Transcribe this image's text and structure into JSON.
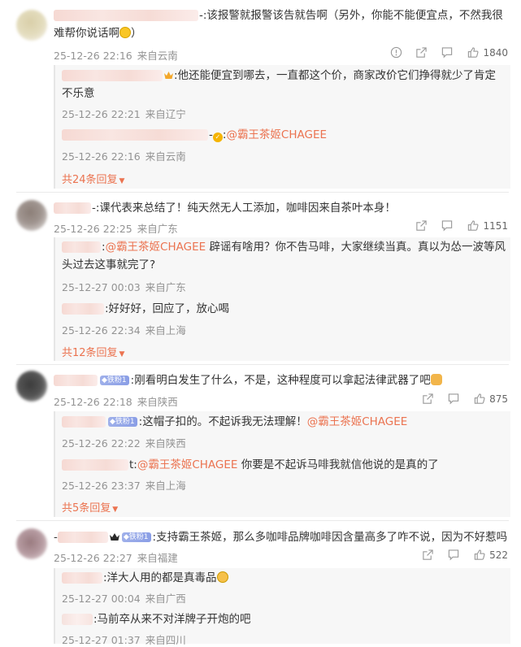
{
  "comments": [
    {
      "text": "-:该报警就报警该告就告啊（另外，你能不能便宜点，不然我很难帮你说话啊",
      "text_tail": "）",
      "time": "25-12-26 22:16",
      "location": "来自云南",
      "likes": "1840",
      "replies": [
        {
          "text": ":他还能便宜到哪去，一直都这个价，商家改价它们挣得就少了肯定不乐意",
          "time": "25-12-26 22:21",
          "location": "来自辽宁"
        },
        {
          "prefix": "-",
          "mention": "@霸王茶姬CHAGEE",
          "colon": ":",
          "time": "25-12-26 22:16",
          "location": "来自云南"
        }
      ],
      "more": "共24条回复"
    },
    {
      "text": "-:课代表来总结了！纯天然无人工添加，咖啡因来自茶叶本身！",
      "time": "25-12-26 22:25",
      "location": "来自广东",
      "likes": "1151",
      "replies": [
        {
          "colon": ":",
          "mention": "@霸王茶姬CHAGEE",
          "text": " 辟谣有啥用？你不告马啡，大家继续当真。真以为怂一波等风头过去这事就完了?",
          "time": "25-12-27 00:03",
          "location": "来自广东"
        },
        {
          "text": ":好好好，回应了，放心喝",
          "time": "25-12-26 22:34",
          "location": "来自上海"
        }
      ],
      "more": "共12条回复"
    },
    {
      "badge": "铁粉1",
      "text": ":刚看明白发生了什么，不是，这种程度可以拿起法律武器了吧",
      "time": "25-12-26 22:18",
      "location": "来自陕西",
      "likes": "875",
      "replies": [
        {
          "badge": "铁粉1",
          "text": ":这帽子扣的。不起诉我无法理解！",
          "mention": "@霸王茶姬CHAGEE",
          "time": "25-12-26 22:22",
          "location": "来自陕西"
        },
        {
          "prefix": "t:",
          "mention": "@霸王茶姬CHAGEE",
          "text": " 你要是不起诉马啡我就信他说的是真的了",
          "time": "25-12-26 23:37",
          "location": "来自上海"
        }
      ],
      "more": "共5条回复"
    },
    {
      "badge": "铁粉1",
      "text": ":支持霸王茶姬，那么多咖啡品牌咖啡因含量高多了咋不说，因为不好惹吗",
      "time": "25-12-26 22:27",
      "location": "来自福建",
      "likes": "522",
      "replies": [
        {
          "text": ":洋大人用的都是真毒品",
          "time": "25-12-27 00:04",
          "location": "来自广西"
        },
        {
          "text": ":马前卒从来不对洋牌子开炮的吧",
          "time": "25-12-27 01:37",
          "location": "来自四川"
        }
      ]
    }
  ],
  "icons": {
    "report": "report-icon",
    "share": "share-icon",
    "comment": "comment-icon",
    "like": "like-icon"
  },
  "colors": {
    "accent": "#eb7350",
    "meta": "#939393",
    "reply_bg": "#f7f7f7"
  }
}
